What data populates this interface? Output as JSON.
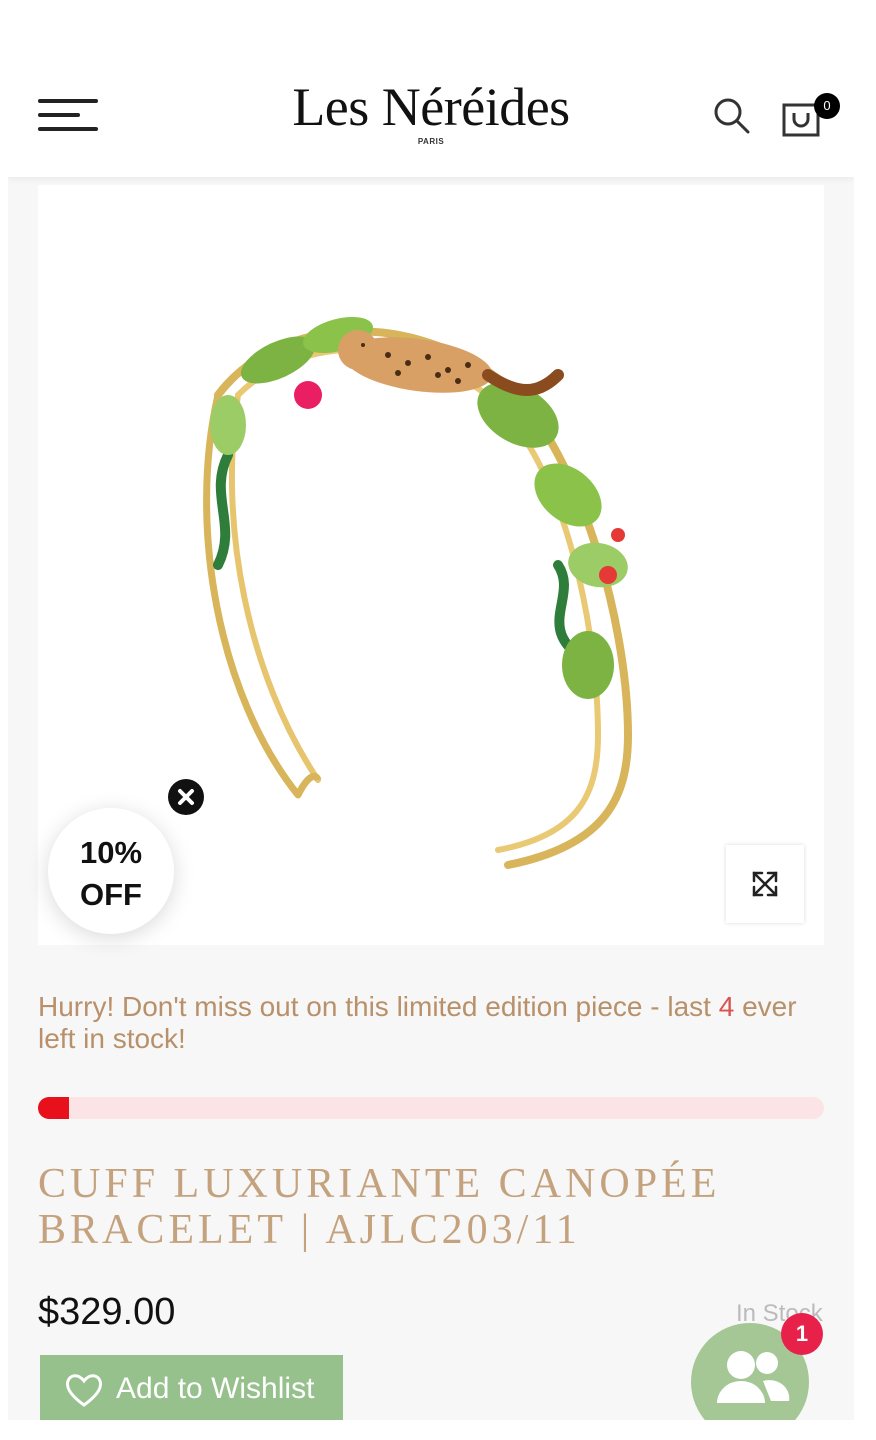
{
  "header": {
    "logo": "Les Néréides",
    "logo_sub": "PARIS",
    "cart_count": "0"
  },
  "icons": {
    "menu": "hamburger-icon",
    "search": "search-icon",
    "cart": "shopping-bag-icon",
    "expand": "expand-icon",
    "close": "close-icon",
    "wishlist": "heart-icon",
    "chat": "users-icon"
  },
  "product": {
    "image_alt": "Luxuriante Canopée cuff bracelet with leopard and leaves",
    "discount_line1": "10%",
    "discount_line2": "OFF",
    "urgency_prefix": "Hurry! Don't miss out on this limited edition piece - last ",
    "urgency_count": "4",
    "urgency_suffix": " ever left in stock!",
    "stock_level": 0.04,
    "title": "CUFF LUXURIANTE CANOPÉE BRACELET | AJLC203/11",
    "price": "$329.00",
    "stock_status": "In Stock",
    "wishlist_label": "Add to Wishlist"
  },
  "chat": {
    "badge": "1"
  },
  "colors": {
    "accent_gold": "#c4a27e",
    "urgency_text": "#b8906a",
    "stock_fill": "#e8101a",
    "stock_track": "#fce4e6",
    "wishlist_bg": "#96c08c",
    "chat_bg": "#a4c795",
    "badge_red": "#e8214b"
  }
}
